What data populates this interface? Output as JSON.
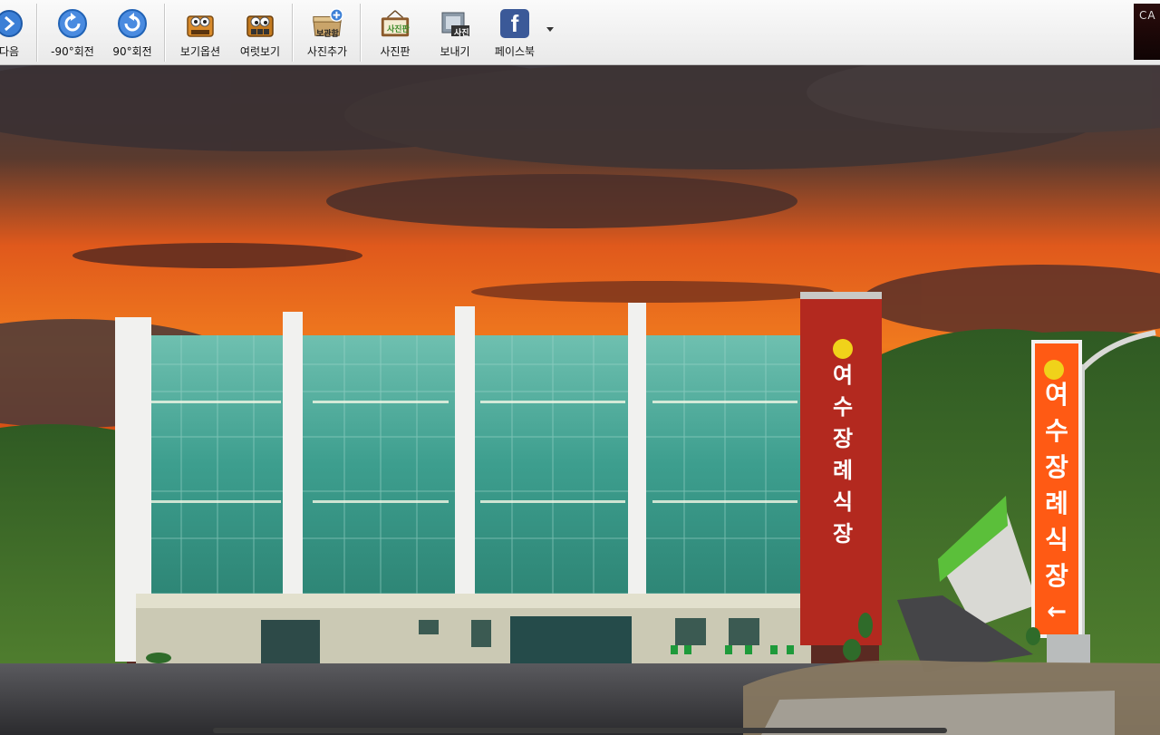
{
  "toolbar": {
    "items": [
      {
        "label": "다음"
      },
      {
        "label": "-90°회전"
      },
      {
        "label": "90°회전"
      },
      {
        "label": "보기옵션"
      },
      {
        "label": "여럿보기"
      },
      {
        "label": "사진추가"
      },
      {
        "label": "사진판"
      },
      {
        "label": "보내기"
      },
      {
        "label": "페이스북"
      }
    ],
    "add_photo_badge": "보관함",
    "board_icon_text": "사진판",
    "send_icon_text": "사진",
    "facebook_glyph": "f",
    "corner_logo_text": "CA"
  },
  "photo": {
    "building_sign": [
      "여",
      "수",
      "장",
      "례",
      "식",
      "장"
    ],
    "pole_sign": [
      "여",
      "수",
      "장",
      "례",
      "식",
      "장"
    ],
    "pole_arrow": "←"
  },
  "colors": {
    "accent_blue": "#3b7fd6",
    "facebook_blue": "#3b5998",
    "sign_red": "#b3291f",
    "sign_orange": "#ff5a14"
  }
}
